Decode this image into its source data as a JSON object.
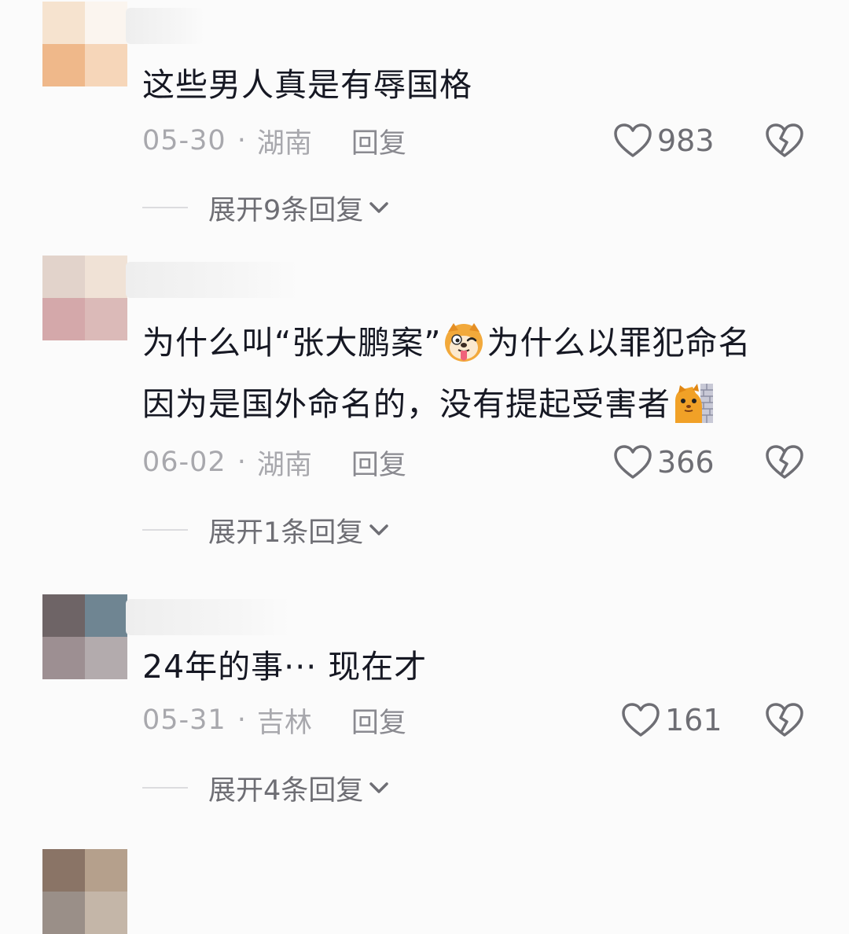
{
  "comments": [
    {
      "text": "这些男人真是有辱国格",
      "date": "05-30",
      "location": "湖南",
      "reply_label": "回复",
      "likes": "983",
      "expand": "展开9条回复"
    },
    {
      "text_line1_a": "为什么叫“张大鹏案”",
      "text_line1_b": "为什么以罪犯命名",
      "text_line2": "因为是国外命名的，没有提起受害者",
      "emoji1": "dog-tongue-emoji",
      "emoji2": "cat-peeking-emoji",
      "date": "06-02",
      "location": "湖南",
      "reply_label": "回复",
      "likes": "366",
      "expand": "展开1条回复"
    },
    {
      "text": "24年的事··· 现在才",
      "date": "05-31",
      "location": "吉林",
      "reply_label": "回复",
      "likes": "161",
      "expand": "展开4条回复"
    }
  ],
  "icons": {
    "like": "heart-outline-icon",
    "dislike": "broken-heart-icon",
    "expand": "chevron-down-icon"
  },
  "colors": {
    "text": "#161823",
    "meta": "#a8a8ad",
    "secondary": "#6e6e74"
  }
}
